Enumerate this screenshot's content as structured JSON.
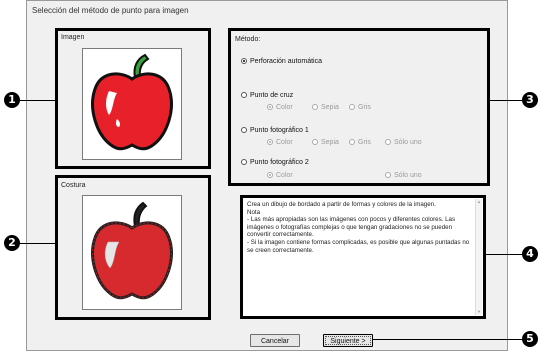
{
  "dialog": {
    "title": "Selección del método de punto para imagen"
  },
  "image_panel": {
    "label": "Imagen"
  },
  "stitch_panel": {
    "label": "Costura"
  },
  "method": {
    "label": "Método:",
    "options": [
      {
        "label": "Perforación automática",
        "selected": true
      },
      {
        "label": "Punto de cruz",
        "selected": false,
        "sub": [
          {
            "label": "Color",
            "selected": true
          },
          {
            "label": "Sepia"
          },
          {
            "label": "Gris"
          }
        ]
      },
      {
        "label": "Punto fotográfico 1",
        "selected": false,
        "sub": [
          {
            "label": "Color",
            "selected": true
          },
          {
            "label": "Sepia"
          },
          {
            "label": "Gris"
          },
          {
            "label": "Sólo uno"
          }
        ]
      },
      {
        "label": "Punto fotográfico 2",
        "selected": false,
        "sub": [
          {
            "label": "Color",
            "selected": true
          },
          {
            "label": "Sólo uno"
          }
        ]
      }
    ]
  },
  "description": {
    "lines": [
      "Crea un dibujo de bordado a partir de formas y colores de la imagen.",
      "Nota",
      "- Las más apropiadas son las imágenes con pocos y diferentes colores. Las imágenes o fotografías complejas o que tengan gradaciones no se pueden convertir correctamente.",
      "- Si la imagen contiene formas complicadas, es posible que algunas puntadas no se creen correctamente."
    ]
  },
  "buttons": {
    "cancel": "Cancelar",
    "next": "Siguiente >"
  },
  "callouts": [
    "1",
    "2",
    "3",
    "4",
    "5"
  ],
  "colors": {
    "apple_red": "#e8202a",
    "apple_leaf": "#3aa23a",
    "stitch_red": "#d62a2e"
  }
}
